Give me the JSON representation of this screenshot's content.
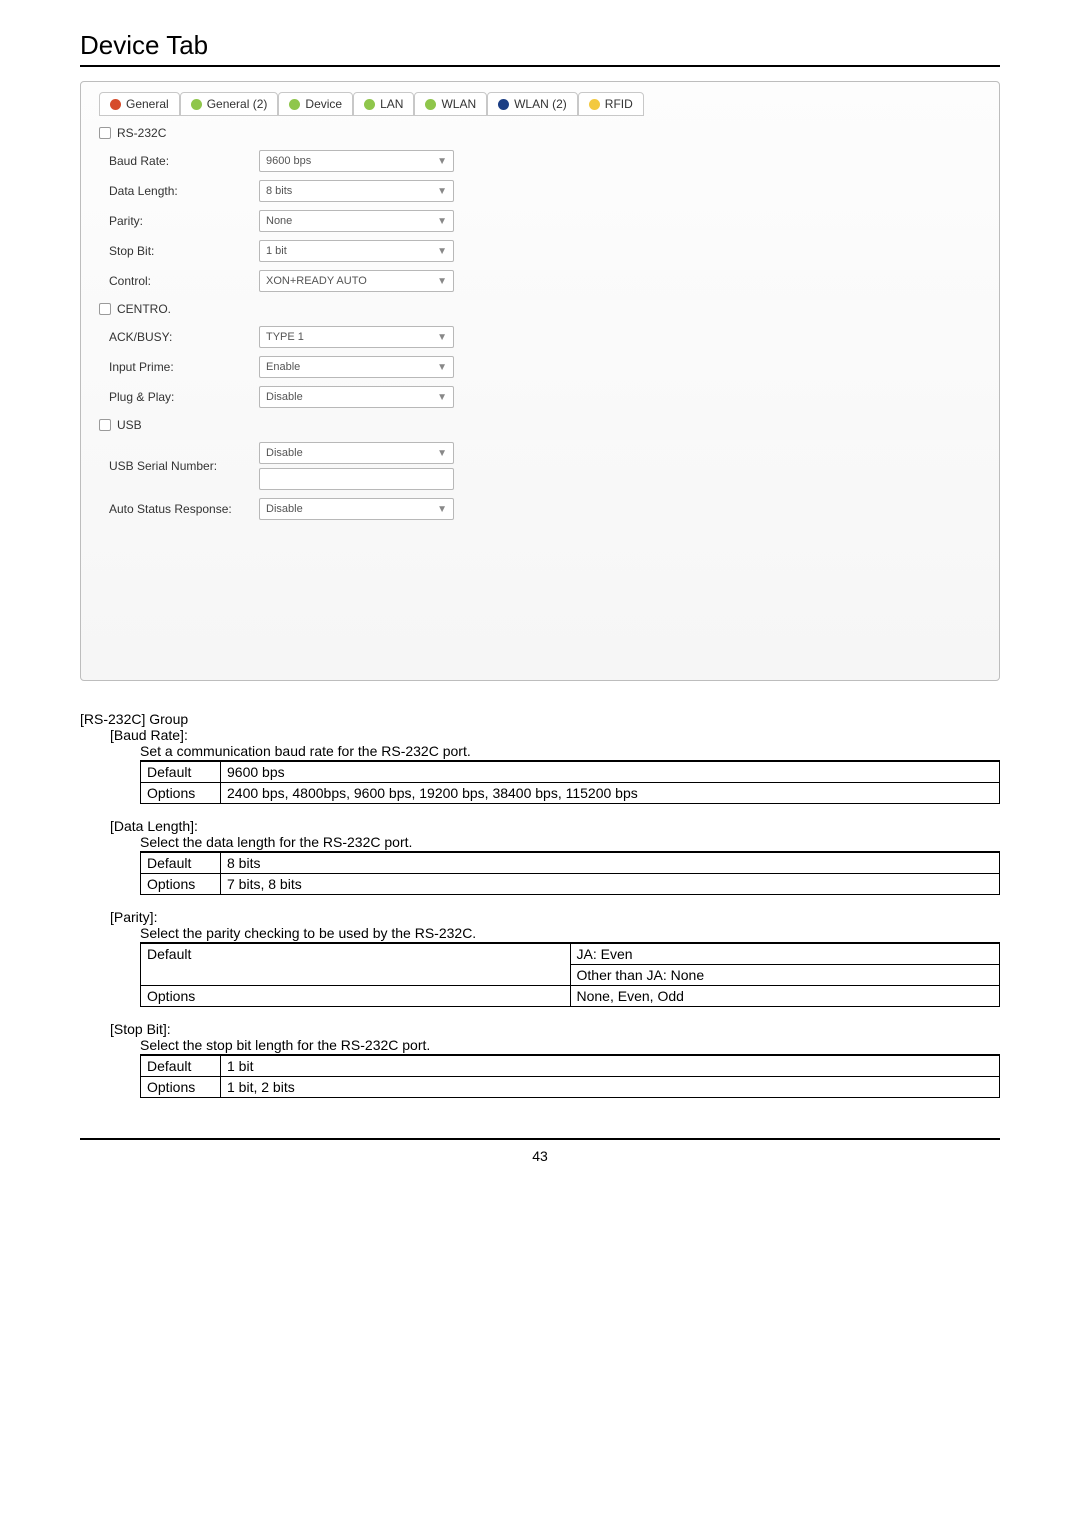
{
  "page": {
    "title": "Device Tab",
    "number": "43"
  },
  "tabColors": {
    "red": "#d64b2a",
    "green": "#8fc64b",
    "darkblue": "#1b3e84",
    "yellow": "#f3c93f"
  },
  "tabs": [
    {
      "label": "General",
      "color": "red"
    },
    {
      "label": "General (2)",
      "color": "green"
    },
    {
      "label": "Device",
      "color": "green"
    },
    {
      "label": "LAN",
      "color": "green"
    },
    {
      "label": "WLAN",
      "color": "green"
    },
    {
      "label": "WLAN (2)",
      "color": "darkblue"
    },
    {
      "label": "RFID",
      "color": "yellow"
    }
  ],
  "sections": {
    "rs232c": {
      "title": "RS-232C",
      "rows": {
        "baud_rate": {
          "label": "Baud Rate:",
          "value": "9600 bps"
        },
        "data_length": {
          "label": "Data Length:",
          "value": "8 bits"
        },
        "parity": {
          "label": "Parity:",
          "value": "None"
        },
        "stop_bit": {
          "label": "Stop Bit:",
          "value": "1 bit"
        },
        "control": {
          "label": "Control:",
          "value": "XON+READY AUTO"
        }
      }
    },
    "centro": {
      "title": "CENTRO.",
      "rows": {
        "ack_busy": {
          "label": "ACK/BUSY:",
          "value": "TYPE 1"
        },
        "input_prime": {
          "label": "Input Prime:",
          "value": "Enable"
        },
        "plug_play": {
          "label": "Plug & Play:",
          "value": "Disable"
        }
      }
    },
    "usb": {
      "title": "USB",
      "rows": {
        "serial": {
          "label": "USB Serial Number:",
          "value": "Disable"
        },
        "auto_status": {
          "label": "Auto Status Response:",
          "value": "Disable"
        }
      }
    }
  },
  "doc": {
    "rs232c_group": "[RS-232C] Group",
    "baud_rate": {
      "label": "[Baud Rate]:",
      "desc": "Set a communication baud rate for the RS-232C port.",
      "default_label": "Default",
      "default_value": "9600 bps",
      "options_label": "Options",
      "options_value": "2400 bps, 4800bps, 9600 bps, 19200 bps, 38400 bps, 115200 bps"
    },
    "data_length": {
      "label": "[Data Length]:",
      "desc": "Select the data length for the RS-232C port.",
      "default_label": "Default",
      "default_value": "8 bits",
      "options_label": "Options",
      "options_value": "7 bits, 8 bits"
    },
    "parity": {
      "label": "[Parity]:",
      "desc": "Select the parity checking to be used by the RS-232C.",
      "default_label": "Default",
      "default_value_1": "JA:    Even",
      "default_value_2": "Other than JA:    None",
      "options_label": "Options",
      "options_value": "None, Even, Odd"
    },
    "stop_bit": {
      "label": "[Stop Bit]:",
      "desc": "Select the stop bit length for the RS-232C port.",
      "default_label": "Default",
      "default_value": "1 bit",
      "options_label": "Options",
      "options_value": "1 bit, 2 bits"
    }
  }
}
